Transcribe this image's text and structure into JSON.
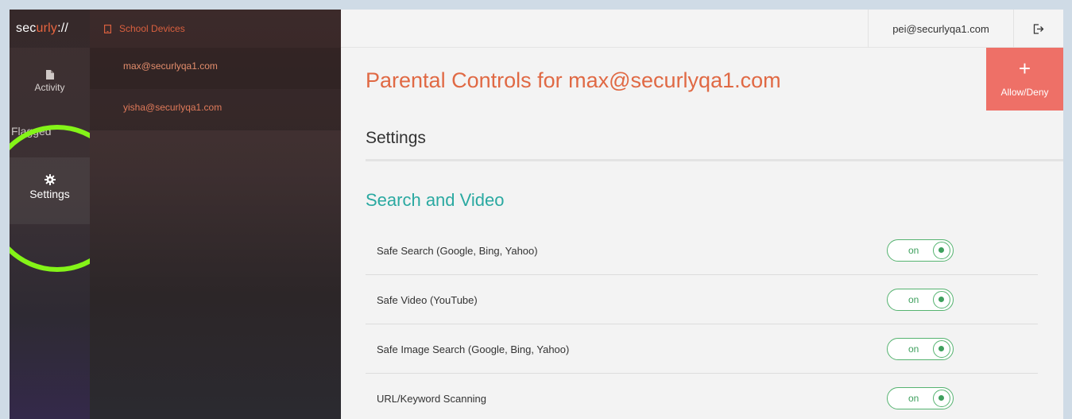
{
  "nav": {
    "logo_prefix": "sec",
    "logo_accent": "urly",
    "logo_suffix": "://",
    "items": [
      {
        "label": "Activity",
        "icon": "document-icon"
      },
      {
        "label": "Flagged",
        "icon": "flag-icon"
      },
      {
        "label": "Settings",
        "icon": "gear-icon"
      }
    ]
  },
  "devices": {
    "header": "School Devices",
    "items": [
      {
        "label": "max@securlyqa1.com",
        "selected": true
      },
      {
        "label": "yisha@securlyqa1.com",
        "selected": false
      }
    ]
  },
  "topbar": {
    "user_email": "pei@securlyqa1.com",
    "logout_icon": "logout-icon"
  },
  "allow_deny": {
    "plus": "+",
    "label": "Allow/Deny"
  },
  "main": {
    "title": "Parental Controls for max@securlyqa1.com",
    "section": "Settings",
    "group": "Search and Video",
    "rows": [
      {
        "label": "Safe Search (Google, Bing, Yahoo)",
        "toggle": "on"
      },
      {
        "label": "Safe Video (YouTube)",
        "toggle": "on"
      },
      {
        "label": "Safe Image Search (Google, Bing, Yahoo)",
        "toggle": "on"
      },
      {
        "label": "URL/Keyword Scanning",
        "toggle": "on"
      }
    ]
  },
  "colors": {
    "accent": "#e06944",
    "teal": "#2aa9a1",
    "toggle_green": "#55b370",
    "allow_button": "#ee7067",
    "highlight": "#84f418"
  }
}
